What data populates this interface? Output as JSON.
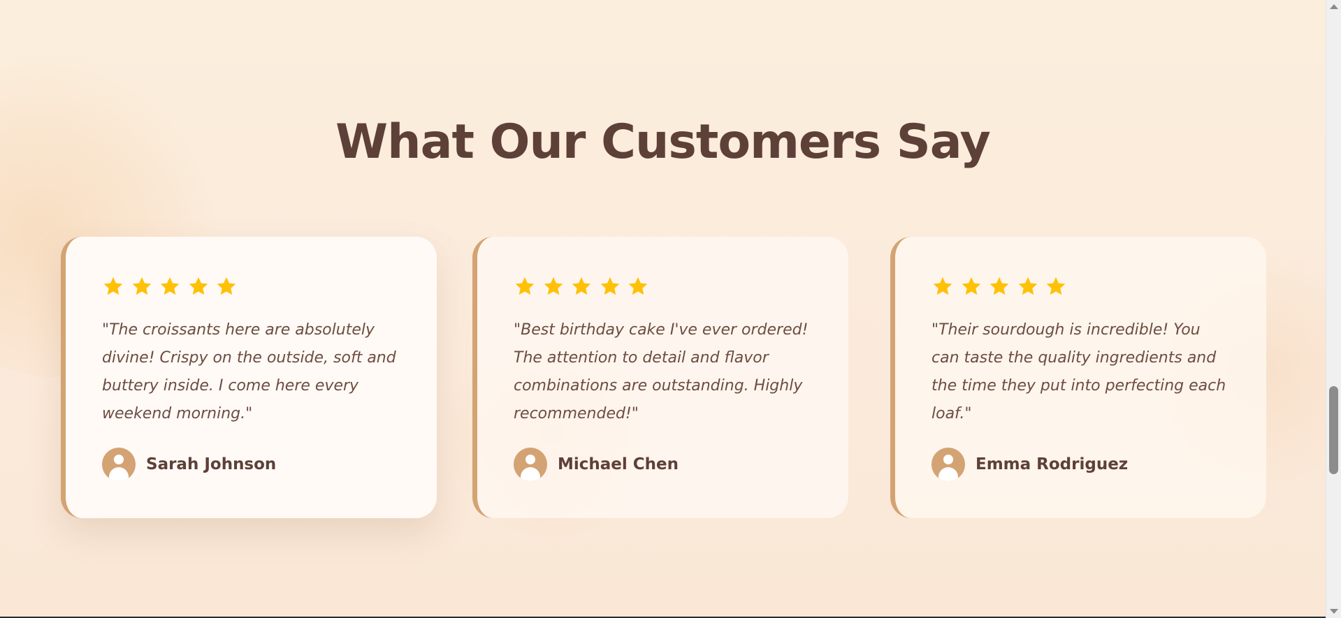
{
  "section": {
    "title": "What Our Customers Say"
  },
  "testimonials": [
    {
      "rating": 5,
      "quote": "\"The croissants here are absolutely divine! Crispy on the outside, soft and buttery inside. I come here every weekend morning.\"",
      "name": "Sarah Johnson"
    },
    {
      "rating": 5,
      "quote": "\"Best birthday cake I've ever ordered! The attention to detail and flavor combinations are outstanding. Highly recommended!\"",
      "name": "Michael Chen"
    },
    {
      "rating": 5,
      "quote": "\"Their sourdough is incredible! You can taste the quality ingredients and the time they put into perfecting each loaf.\"",
      "name": "Emma Rodriguez"
    }
  ],
  "icons": {
    "star": "star-icon",
    "avatar": "user-avatar-icon"
  },
  "colors": {
    "heading": "#5d4037",
    "quote_text": "#6d4c41",
    "accent": "#d4a373",
    "star": "#ffc107"
  }
}
